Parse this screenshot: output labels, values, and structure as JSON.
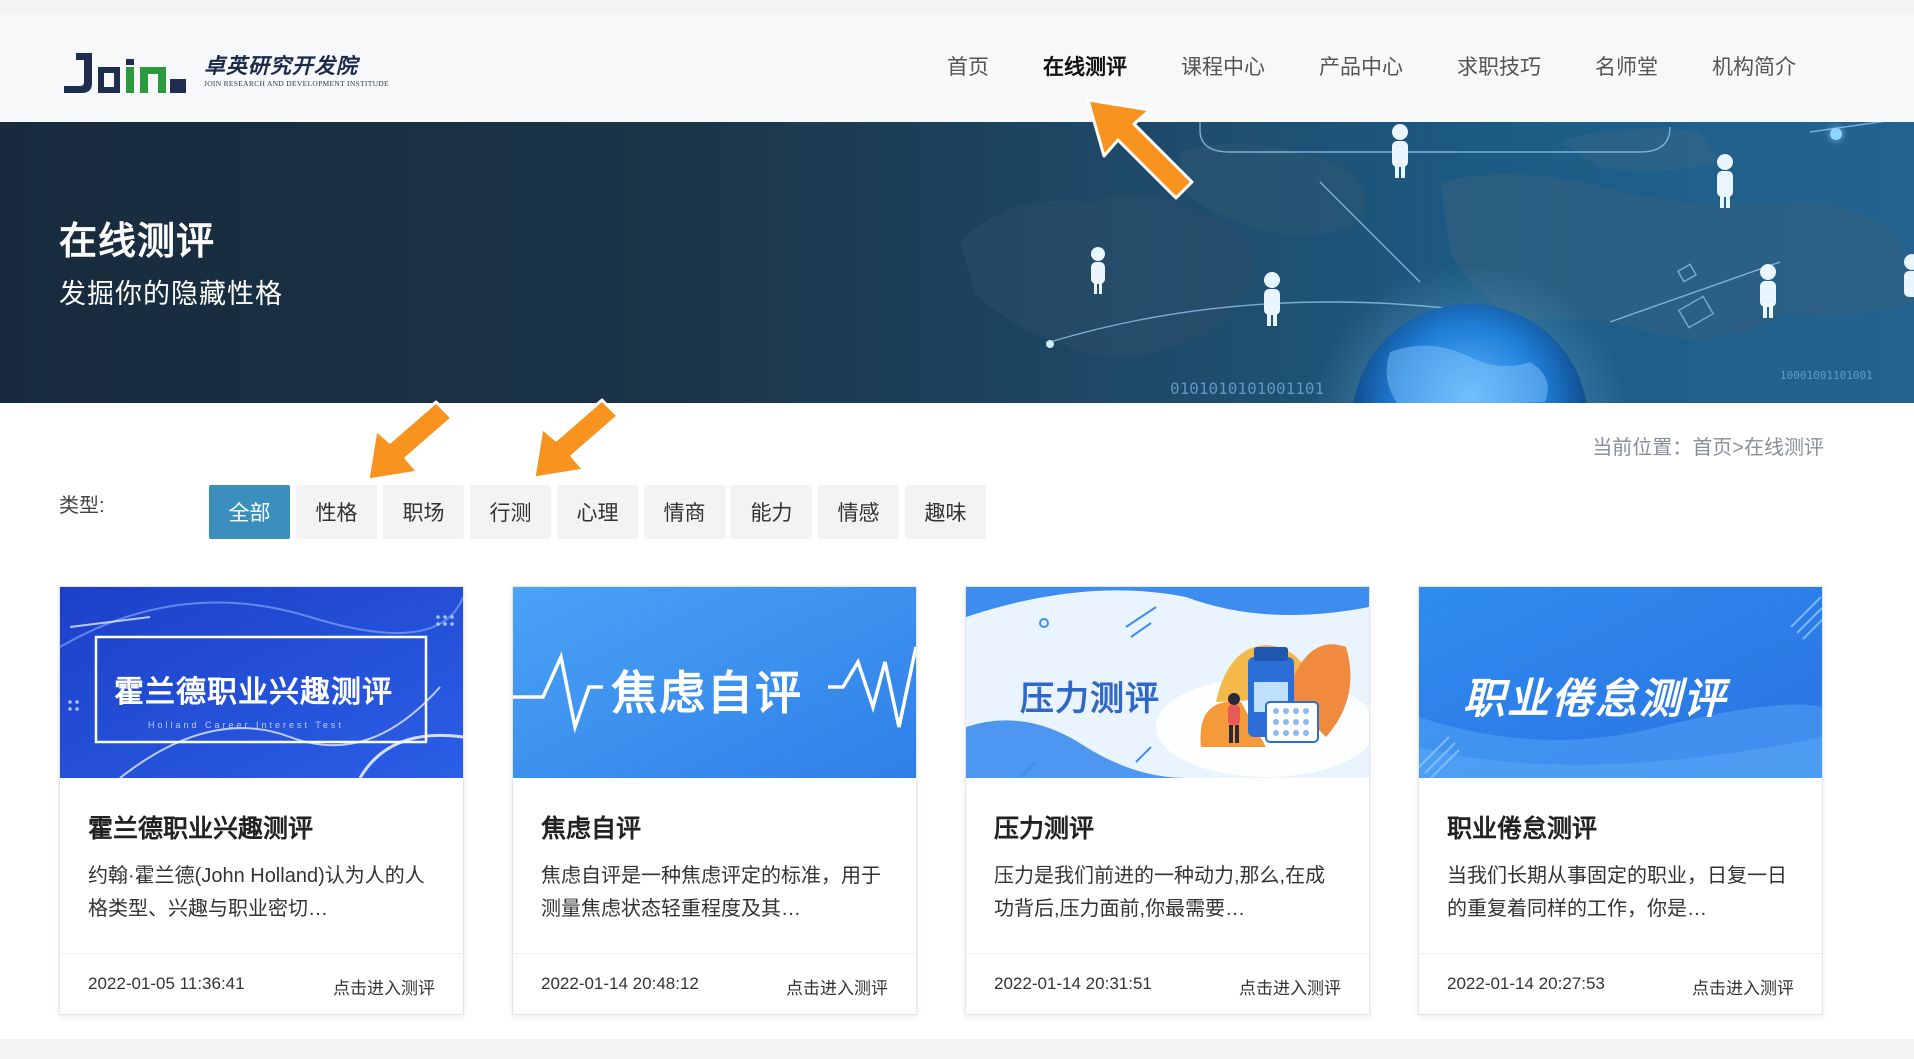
{
  "brand": {
    "logo_word": "Join",
    "name_cn": "卓英研究开发院",
    "name_en": "JOIN RESEARCH AND DEVELOPMENT INSTITUDE"
  },
  "nav": {
    "items": [
      {
        "label": "首页",
        "active": false
      },
      {
        "label": "在线测评",
        "active": true
      },
      {
        "label": "课程中心",
        "active": false
      },
      {
        "label": "产品中心",
        "active": false
      },
      {
        "label": "求职技巧",
        "active": false
      },
      {
        "label": "名师堂",
        "active": false
      },
      {
        "label": "机构简介",
        "active": false
      }
    ]
  },
  "banner": {
    "title": "在线测评",
    "subtitle": "发掘你的隐藏性格",
    "binary_1": "0101010101001101",
    "binary_2": "10001001101001"
  },
  "breadcrumb": {
    "prefix": "当前位置：",
    "path": "首页>在线测评"
  },
  "filter": {
    "label": "类型:",
    "chips": [
      {
        "label": "全部",
        "active": true
      },
      {
        "label": "性格",
        "active": false
      },
      {
        "label": "职场",
        "active": false
      },
      {
        "label": "行测",
        "active": false
      },
      {
        "label": "心理",
        "active": false
      },
      {
        "label": "情商",
        "active": false
      },
      {
        "label": "能力",
        "active": false
      },
      {
        "label": "情感",
        "active": false
      },
      {
        "label": "趣味",
        "active": false
      }
    ]
  },
  "cards": [
    {
      "image_text": "霍兰德职业兴趣测评",
      "image_subtext": "Holland Career Interest Test",
      "title": "霍兰德职业兴趣测评",
      "desc": "约翰·霍兰德(John Holland)认为人的人格类型、兴趣与职业密切…",
      "date": "2022-01-05 11:36:41",
      "link": "点击进入测评"
    },
    {
      "image_text": "焦虑自评",
      "title": "焦虑自评",
      "desc": "焦虑自评是一种焦虑评定的标准，用于测量焦虑状态轻重程度及其…",
      "date": "2022-01-14 20:48:12",
      "link": "点击进入测评"
    },
    {
      "image_text": "压力测评",
      "title": "压力测评",
      "desc": "压力是我们前进的一种动力,那么,在成功背后,压力面前,你最需要…",
      "date": "2022-01-14 20:31:51",
      "link": "点击进入测评"
    },
    {
      "image_text": "职业倦怠测评",
      "title": "职业倦怠测评",
      "desc": "当我们长期从事固定的职业，日复一日的重复着同样的工作，你是…",
      "date": "2022-01-14 20:27:53",
      "link": "点击进入测评"
    }
  ],
  "colors": {
    "accent": "#3b8fbd",
    "annotation_arrow": "#f7931e"
  }
}
